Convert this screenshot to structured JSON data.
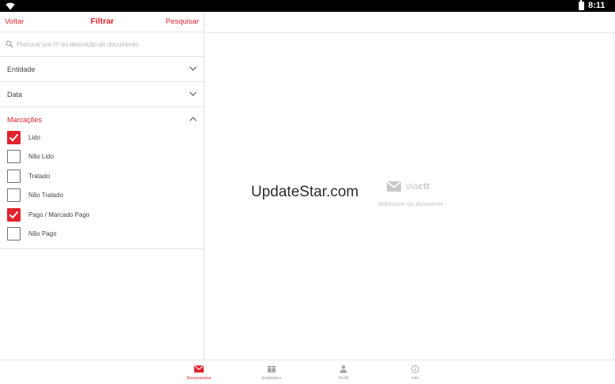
{
  "status_bar": {
    "time": "8:11",
    "icons": [
      "wifi-icon",
      "battery-icon"
    ]
  },
  "filter": {
    "back_label": "Voltar",
    "title": "Filtrar",
    "search_label": "Pesquisar",
    "search_placeholder": "Procurar por nº ou descrição do documento",
    "sections": [
      {
        "label": "Entidade",
        "expanded": false
      },
      {
        "label": "Data",
        "expanded": false
      }
    ],
    "marcacoes": {
      "label": "Marcações",
      "expanded": true,
      "options": [
        {
          "label": "Lido",
          "checked": true
        },
        {
          "label": "Não Lido",
          "checked": false
        },
        {
          "label": "Tratado",
          "checked": false
        },
        {
          "label": "Não Tratado",
          "checked": false
        },
        {
          "label": "Pago / Marcado Pago",
          "checked": true
        },
        {
          "label": "Não Pago",
          "checked": false
        }
      ]
    }
  },
  "detail": {
    "watermark": "UpdateStar.com",
    "logo_via": "via",
    "logo_ctt": "ctt",
    "empty_hint": "Seleccione um documento"
  },
  "bottom_nav": {
    "items": [
      {
        "label": "Documentos",
        "icon": "envelope-icon",
        "active": true
      },
      {
        "label": "Entidades",
        "icon": "box-icon",
        "active": false
      },
      {
        "label": "Perfil",
        "icon": "person-icon",
        "active": false
      },
      {
        "label": "Info",
        "icon": "info-icon",
        "active": false
      }
    ]
  },
  "colors": {
    "accent": "#e0232d",
    "divider": "#e6e6e6",
    "muted_text": "#999999"
  }
}
